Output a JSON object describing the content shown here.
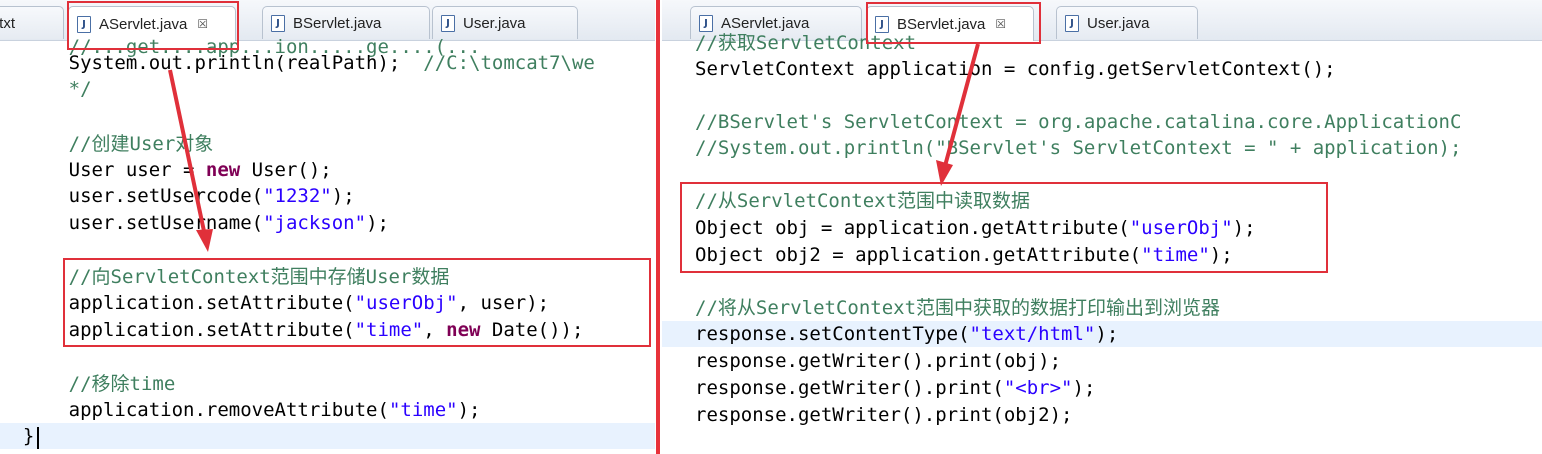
{
  "left_editor": {
    "tabs": [
      {
        "label": ".txt",
        "active": false,
        "icon": "text-file-icon",
        "close": ""
      },
      {
        "label": "AServlet.java",
        "active": true,
        "icon": "java-file-icon",
        "close": "☒"
      },
      {
        "label": "BServlet.java",
        "active": false,
        "icon": "java-file-icon",
        "close": ""
      },
      {
        "label": "User.java",
        "active": false,
        "icon": "java-file-icon",
        "close": ""
      }
    ],
    "lines": [
      "      //...get....app...ion.....ge....(...",
      "      System.out.println(realPath);  //C:\\tomcat7\\we",
      "      */",
      "",
      "      //创建User对象",
      "      User user = new User();",
      "      user.setUsercode(\"1232\");",
      "      user.setUsername(\"jackson\");",
      "",
      "      //向ServletContext范围中存储User数据",
      "      application.setAttribute(\"userObj\", user);",
      "      application.setAttribute(\"time\", new Date());",
      "",
      "      //移除time",
      "      application.removeAttribute(\"time\");",
      "  }"
    ]
  },
  "right_editor": {
    "tabs": [
      {
        "label": "AServlet.java",
        "active": false,
        "icon": "java-file-icon",
        "close": ""
      },
      {
        "label": "BServlet.java",
        "active": true,
        "icon": "java-file-icon",
        "close": "☒"
      },
      {
        "label": "User.java",
        "active": false,
        "icon": "java-file-icon",
        "close": ""
      }
    ],
    "lines": [
      "//获取ServletContext",
      "ServletContext application = config.getServletContext();",
      "",
      "//BServlet's ServletContext = org.apache.catalina.core.ApplicationC",
      "//System.out.println(\"BServlet's ServletContext = \" + application);",
      "",
      "//从ServletContext范围中读取数据",
      "Object obj = application.getAttribute(\"userObj\");",
      "Object obj2 = application.getAttribute(\"time\");",
      "",
      "//将从ServletContext范围中获取的数据打印输出到浏览器",
      "response.setContentType(\"text/html\");",
      "response.getWriter().print(obj);",
      "response.getWriter().print(\"<br>\");",
      "response.getWriter().print(obj2);"
    ]
  },
  "colors": {
    "comment": "#3f7f5f",
    "string": "#2a00ff",
    "keyword": "#7f0055",
    "annotation_red": "#e0303a",
    "current_line": "#e8f2fe"
  }
}
